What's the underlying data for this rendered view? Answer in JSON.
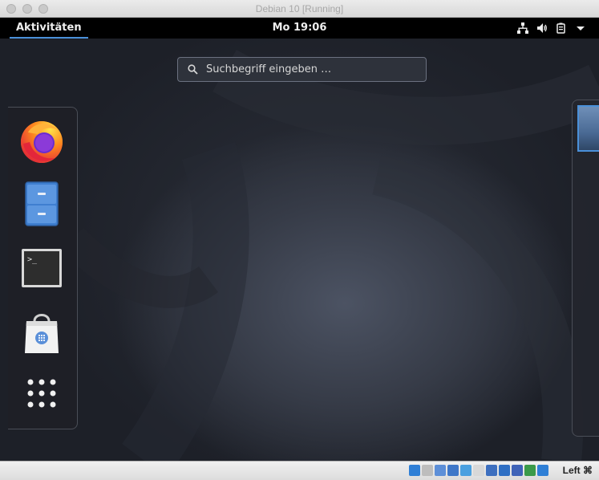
{
  "window": {
    "title": "Debian 10 [Running]"
  },
  "topbar": {
    "activities_label": "Aktivitäten",
    "clock": "Mo 19:06",
    "tray_icons": [
      "network-icon",
      "volume-icon",
      "battery-icon",
      "menu-arrow-icon"
    ]
  },
  "search": {
    "placeholder": "Suchbegriff eingeben …"
  },
  "dash": {
    "apps": [
      {
        "name": "firefox-icon"
      },
      {
        "name": "files-icon"
      },
      {
        "name": "terminal-icon"
      },
      {
        "name": "software-icon"
      },
      {
        "name": "show-applications-icon"
      }
    ]
  },
  "statusbar": {
    "host_key": "Left ⌘",
    "icon_colors": [
      "#2f7fd6",
      "#bdbdbd",
      "#5d8fd8",
      "#3f77c8",
      "#4aa0e0",
      "#d8d8d8",
      "#3d6fbf",
      "#2f6fc4",
      "#3f63b8",
      "#3a9a4a",
      "#2f7fd6"
    ]
  },
  "colors": {
    "accent": "#4a90d9"
  }
}
